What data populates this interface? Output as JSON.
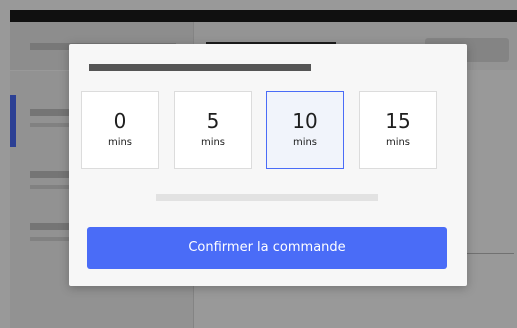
{
  "colors": {
    "accent": "#4a6cf7",
    "overlay": "rgba(0,0,0,0.40)",
    "modal_background": "#f7f7f7",
    "selected_option_background": "#f1f4fb"
  },
  "modal": {
    "options": [
      {
        "value": "0",
        "unit": "mins",
        "selected": false
      },
      {
        "value": "5",
        "unit": "mins",
        "selected": false
      },
      {
        "value": "10",
        "unit": "mins",
        "selected": true
      },
      {
        "value": "15",
        "unit": "mins",
        "selected": false
      }
    ],
    "confirm_label": "Confirmer la commande"
  }
}
